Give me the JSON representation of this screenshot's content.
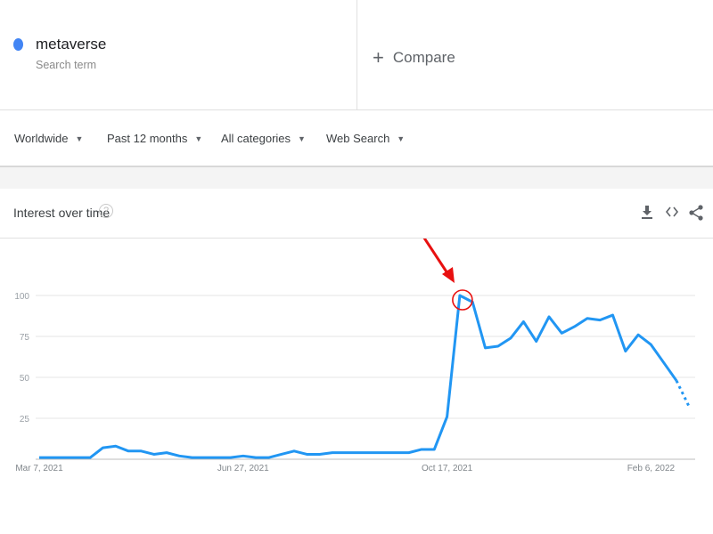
{
  "term": {
    "name": "metaverse",
    "subtitle": "Search term",
    "color": "#4285f4"
  },
  "compare": {
    "label": "Compare"
  },
  "filters": [
    {
      "label": "Worldwide"
    },
    {
      "label": "Past 12 months"
    },
    {
      "label": "All categories"
    },
    {
      "label": "Web Search"
    }
  ],
  "card": {
    "title": "Interest over time",
    "icons": [
      "help-icon",
      "download-icon",
      "embed-icon",
      "share-icon"
    ]
  },
  "annotation": {
    "type": "red arrow and circle",
    "target": "Oct 24, 2021",
    "color": "#e81010"
  },
  "chart_data": {
    "type": "line",
    "title": "Interest over time",
    "xlabel": "",
    "ylabel": "",
    "ylim": [
      0,
      100
    ],
    "yticks": [
      25,
      50,
      75,
      100
    ],
    "xtick_labels": [
      "Mar 7, 2021",
      "Jun 27, 2021",
      "Oct 17, 2021",
      "Feb 6, 2022"
    ],
    "grid": true,
    "line_color": "#2196f3",
    "partial_last_point": true,
    "x": [
      "2021-03-07",
      "2021-03-14",
      "2021-03-21",
      "2021-03-28",
      "2021-04-04",
      "2021-04-11",
      "2021-04-18",
      "2021-04-25",
      "2021-05-02",
      "2021-05-09",
      "2021-05-16",
      "2021-05-23",
      "2021-05-30",
      "2021-06-06",
      "2021-06-13",
      "2021-06-20",
      "2021-06-27",
      "2021-07-04",
      "2021-07-11",
      "2021-07-18",
      "2021-07-25",
      "2021-08-01",
      "2021-08-08",
      "2021-08-15",
      "2021-08-22",
      "2021-08-29",
      "2021-09-05",
      "2021-09-12",
      "2021-09-19",
      "2021-09-26",
      "2021-10-03",
      "2021-10-10",
      "2021-10-17",
      "2021-10-24",
      "2021-10-31",
      "2021-11-07",
      "2021-11-14",
      "2021-11-21",
      "2021-11-28",
      "2021-12-05",
      "2021-12-12",
      "2021-12-19",
      "2021-12-26",
      "2022-01-02",
      "2022-01-09",
      "2022-01-16",
      "2022-01-23",
      "2022-01-30",
      "2022-02-06",
      "2022-02-13",
      "2022-02-20",
      "2022-02-27"
    ],
    "series": [
      {
        "values": [
          1,
          1,
          1,
          1,
          1,
          7,
          8,
          5,
          5,
          3,
          4,
          2,
          1,
          1,
          1,
          1,
          2,
          1,
          1,
          3,
          5,
          3,
          3,
          4,
          4,
          4,
          4,
          4,
          4,
          4,
          6,
          6,
          26,
          100,
          96,
          68,
          69,
          74,
          84,
          72,
          87,
          77,
          81,
          86,
          85,
          88,
          66,
          76,
          70,
          59,
          48,
          32
        ]
      }
    ]
  }
}
